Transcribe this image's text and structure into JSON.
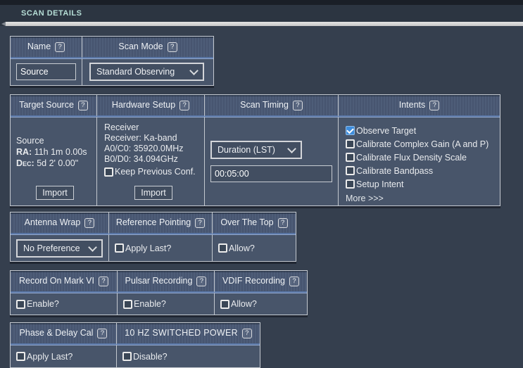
{
  "ui": {
    "help_glyph": "?"
  },
  "colors": {
    "title": "#b6ded6",
    "header_accent": "#5a77a6",
    "checkbox_checked_fill": "#3e8ddd",
    "page_bg": "#353f4e",
    "cell_bg": "#48556a",
    "divider_bar": "#d5d5d5"
  },
  "header": {
    "title": "SCAN DETAILS"
  },
  "scan_name_table": {
    "columns": [
      {
        "label": "Name"
      },
      {
        "label": "Scan Mode"
      }
    ],
    "name_value": "Source",
    "scan_mode_value": "Standard Observing"
  },
  "scan_table": {
    "columns": [
      {
        "label": "Target Source"
      },
      {
        "label": "Hardware Setup"
      },
      {
        "label": "Scan Timing"
      },
      {
        "label": "Intents"
      }
    ],
    "target_source": {
      "source_name": "Source",
      "ra_label": "RA:",
      "ra_value": "11h 1m 0.00s",
      "dec_label": "Dec:",
      "dec_value": "5d 2' 0.00\"",
      "import_label": "Import"
    },
    "hardware_setup": {
      "title": "Receiver",
      "receiver_line": "Receiver: Ka-band",
      "a0c0_line": "A0/C0: 35920.0MHz",
      "b0d0_line": "B0/D0: 34.094GHz",
      "keep_previous": {
        "label": "Keep Previous Conf.",
        "checked": false
      },
      "import_label": "Import"
    },
    "scan_timing": {
      "timing_type_value": "Duration (LST)",
      "duration_value": "00:05:00"
    },
    "intents": {
      "options": [
        {
          "label": "Observe Target",
          "checked": true
        },
        {
          "label": "Calibrate Complex Gain (A and P)",
          "checked": false
        },
        {
          "label": "Calibrate Flux Density Scale",
          "checked": false
        },
        {
          "label": "Calibrate Bandpass",
          "checked": false
        },
        {
          "label": "Setup Intent",
          "checked": false
        }
      ],
      "more_label": "More >>>"
    }
  },
  "wrap_table": {
    "columns": [
      {
        "label": "Antenna Wrap"
      },
      {
        "label": "Reference Pointing"
      },
      {
        "label": "Over The Top"
      }
    ],
    "antenna_wrap_value": "No Preference",
    "reference_pointing": {
      "label": "Apply Last?",
      "checked": false
    },
    "over_the_top": {
      "label": "Allow?",
      "checked": false
    }
  },
  "recording_table": {
    "columns": [
      {
        "label": "Record On Mark VI"
      },
      {
        "label": "Pulsar Recording"
      },
      {
        "label": "VDIF Recording"
      }
    ],
    "mark_vi": {
      "label": "Enable?",
      "checked": false
    },
    "pulsar": {
      "label": "Enable?",
      "checked": false
    },
    "vdif": {
      "label": "Allow?",
      "checked": false
    }
  },
  "cal_table": {
    "columns": [
      {
        "label": "Phase & Delay Cal"
      },
      {
        "label": "10 HZ SWITCHED POWER"
      }
    ],
    "phase_delay": {
      "label": "Apply Last?",
      "checked": false
    },
    "switched_power": {
      "label": "Disable?",
      "checked": false
    }
  }
}
